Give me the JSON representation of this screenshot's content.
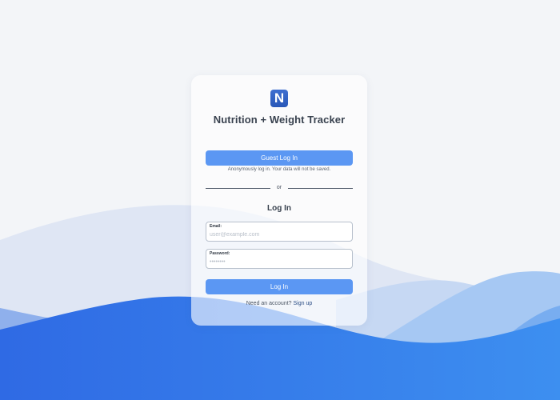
{
  "app": {
    "logo_letter": "N",
    "title": "Nutrition + Weight Tracker"
  },
  "guest": {
    "button_label": "Guest Log In",
    "note": "Anonymously log in. Your data will not be saved."
  },
  "divider": {
    "label": "or"
  },
  "login": {
    "heading": "Log In",
    "email_label": "Email:",
    "email_placeholder": "user@example.com",
    "password_label": "Password:",
    "password_placeholder": "••••••••",
    "button_label": "Log In"
  },
  "signup": {
    "prompt": "Need an account?",
    "link_label": "Sign up"
  },
  "colors": {
    "accent": "#5b97f3",
    "logo": "#2f5fbf",
    "background": "#f3f5f8",
    "wave_deep": "#2f6fe6"
  },
  "icons": {
    "logo": "app-logo-n-icon"
  }
}
